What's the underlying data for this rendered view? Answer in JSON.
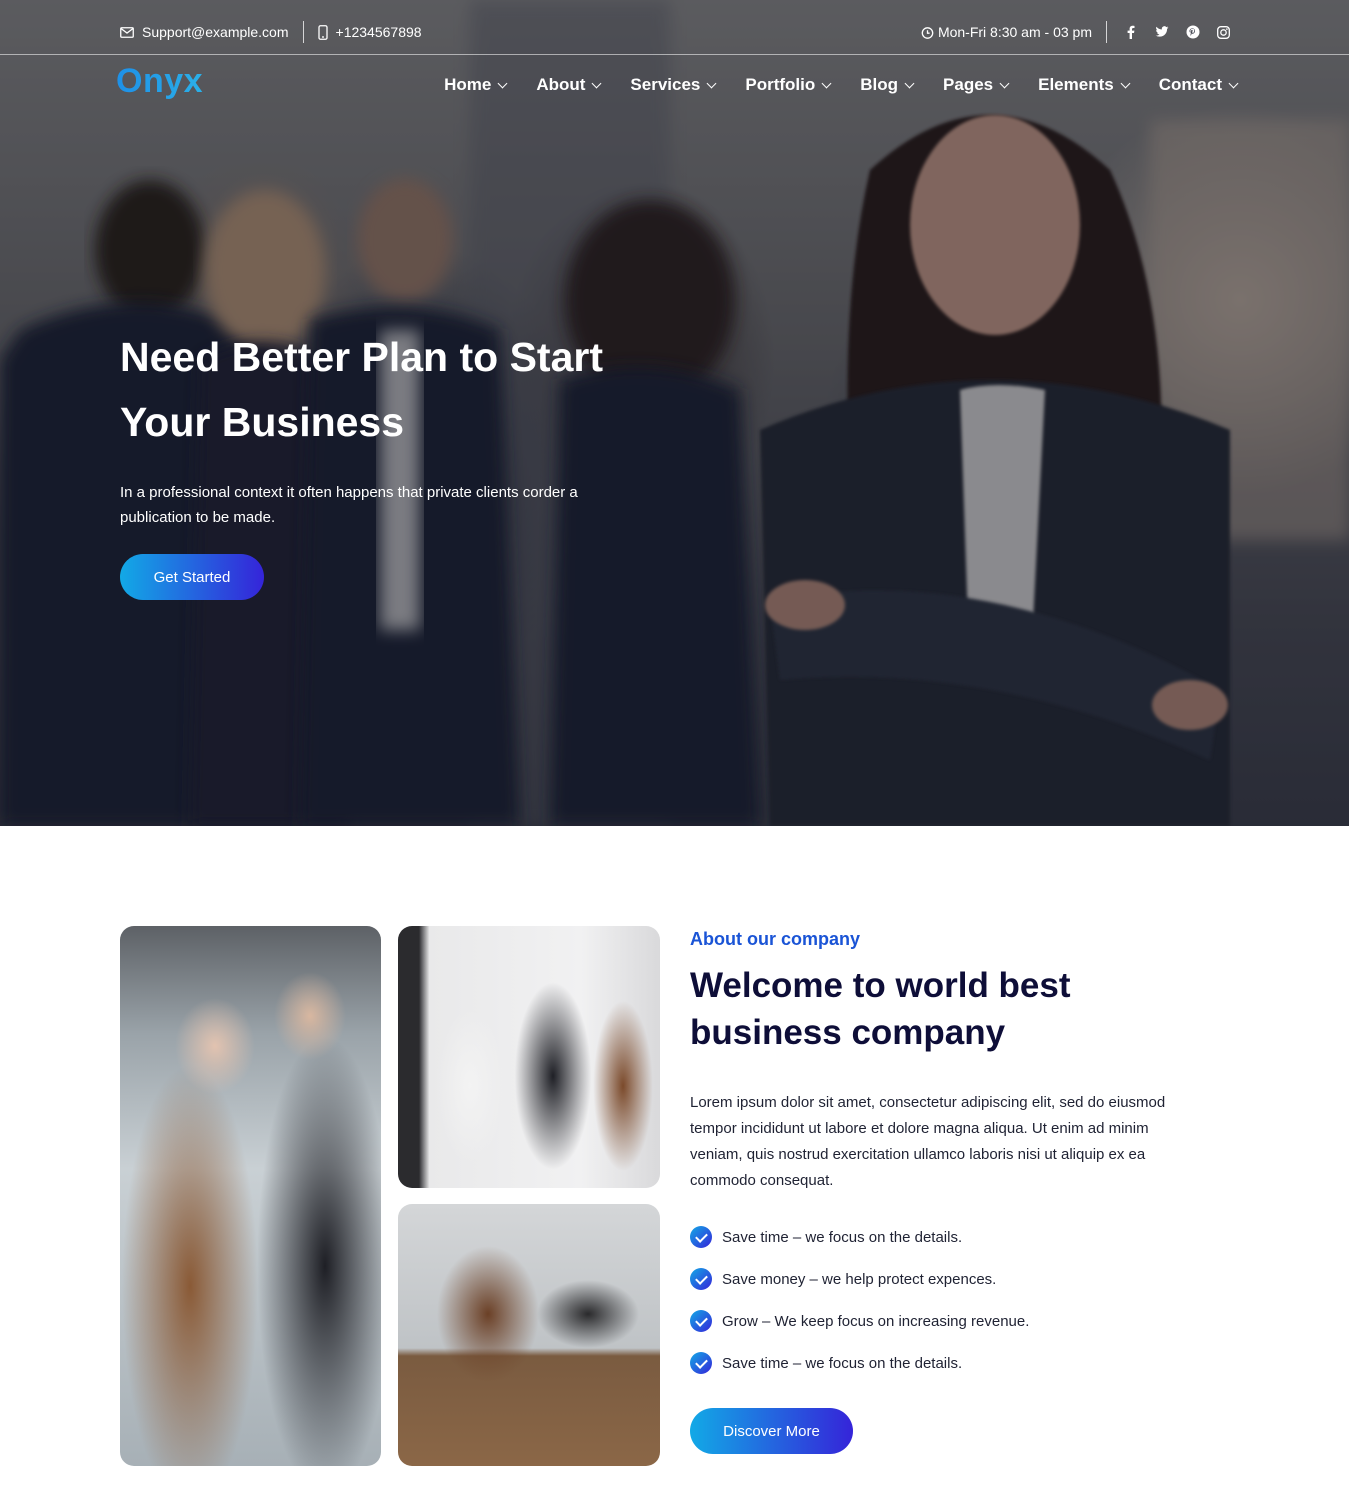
{
  "topbar": {
    "email": "Support@example.com",
    "phone": "+1234567898",
    "hours": "Mon-Fri 8:30 am - 03 pm",
    "icons": {
      "email": "envelope-icon",
      "phone": "mobile-phone-icon",
      "hours": "clock-icon"
    },
    "social": [
      {
        "name": "facebook",
        "glyph": "f"
      },
      {
        "name": "twitter",
        "glyph": "t"
      },
      {
        "name": "pinterest",
        "glyph": "p"
      },
      {
        "name": "instagram",
        "glyph": "◎"
      }
    ]
  },
  "nav": {
    "logo": "Onyx",
    "items": [
      {
        "label": "Home"
      },
      {
        "label": "About"
      },
      {
        "label": "Services"
      },
      {
        "label": "Portfolio"
      },
      {
        "label": "Blog"
      },
      {
        "label": "Pages"
      },
      {
        "label": "Elements"
      },
      {
        "label": "Contact"
      }
    ]
  },
  "hero": {
    "title_line1": "Need Better Plan to Start",
    "title_line2": "Your Business",
    "text_line1": "In a professional context it often happens that private clients corder a",
    "text_line2": "publication to be made.",
    "cta": "Get Started"
  },
  "about": {
    "subtitle": "About our company",
    "title_line1": "Welcome to world best",
    "title_line2": "business company",
    "paragraph_line1": "Lorem ipsum dolor sit amet, consectetur adipiscing elit, sed do eiusmod",
    "paragraph_line2": "tempor incididunt ut labore et dolore magna aliqua. Ut enim ad minim",
    "paragraph_line3": "veniam, quis nostrud exercitation ullamco laboris nisi ut aliquip ex ea",
    "paragraph_line4": "commodo consequat.",
    "checklist": [
      "Save time – we focus on the details.",
      "Save money – we help protect expences.",
      "Grow – We keep focus on increasing revenue.",
      "Save time – we focus on the details."
    ],
    "cta": "Discover More"
  },
  "colors": {
    "accent_blue": "#1a54d6",
    "heading_dark": "#0e0e38",
    "gradient_start": "#12a9e6",
    "gradient_end": "#3524d9"
  }
}
